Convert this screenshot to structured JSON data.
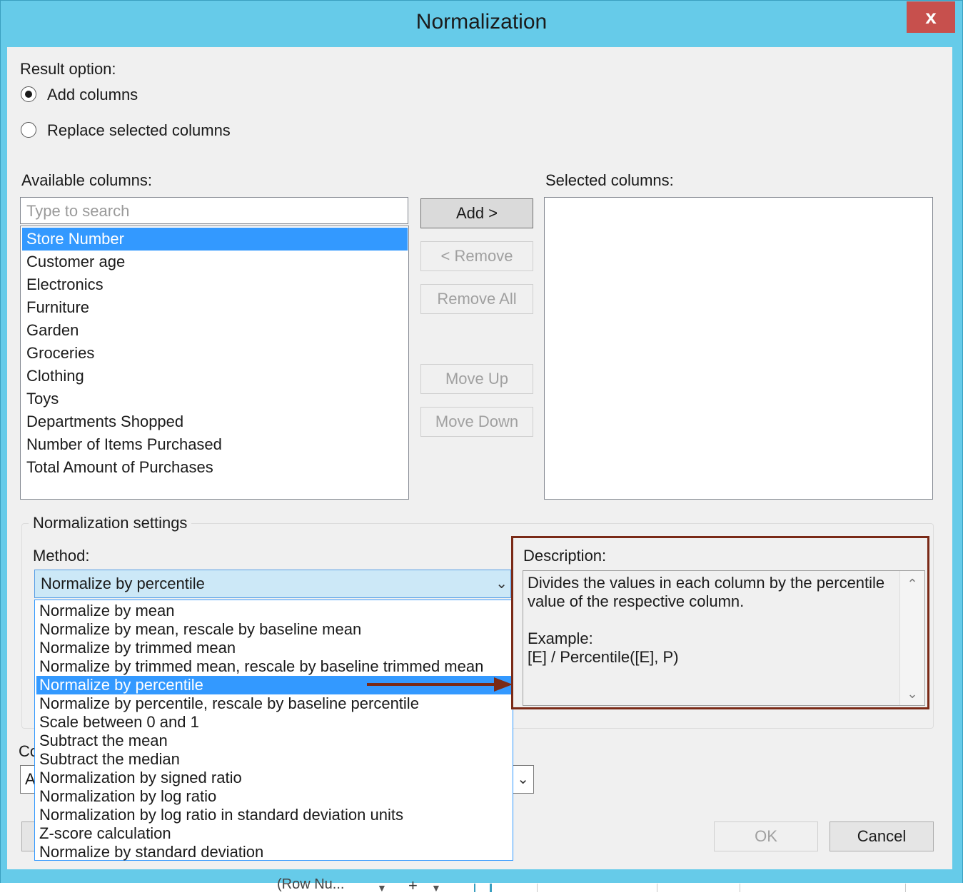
{
  "window": {
    "title": "Normalization",
    "close_label": "x"
  },
  "result_option": {
    "label": "Result option:",
    "options": [
      {
        "label": "Add columns",
        "selected": true
      },
      {
        "label": "Replace selected columns",
        "selected": false
      }
    ]
  },
  "available_columns": {
    "label": "Available columns:",
    "search_placeholder": "Type to search",
    "items": [
      {
        "label": "Store Number",
        "selected": true
      },
      {
        "label": "Customer age",
        "selected": false
      },
      {
        "label": "Electronics",
        "selected": false
      },
      {
        "label": "Furniture",
        "selected": false
      },
      {
        "label": "Garden",
        "selected": false
      },
      {
        "label": "Groceries",
        "selected": false
      },
      {
        "label": "Clothing",
        "selected": false
      },
      {
        "label": "Toys",
        "selected": false
      },
      {
        "label": "Departments Shopped",
        "selected": false
      },
      {
        "label": "Number of Items Purchased",
        "selected": false
      },
      {
        "label": "Total Amount of Purchases",
        "selected": false
      }
    ]
  },
  "buttons": {
    "add": "Add >",
    "remove": "< Remove",
    "remove_all": "Remove All",
    "move_up": "Move Up",
    "move_down": "Move Down",
    "ok": "OK",
    "cancel": "Cancel"
  },
  "selected_columns": {
    "label": "Selected columns:",
    "items": []
  },
  "normalization_settings": {
    "group_label": "Normalization settings",
    "method_label": "Method:",
    "method_value": "Normalize by percentile",
    "method_options": [
      {
        "label": "Normalize by mean",
        "selected": false
      },
      {
        "label": "Normalize by mean, rescale by baseline mean",
        "selected": false
      },
      {
        "label": "Normalize by trimmed mean",
        "selected": false
      },
      {
        "label": "Normalize by trimmed mean, rescale by baseline trimmed mean",
        "selected": false
      },
      {
        "label": "Normalize by percentile",
        "selected": true
      },
      {
        "label": "Normalize by percentile, rescale by baseline percentile",
        "selected": false
      },
      {
        "label": "Scale between 0 and 1",
        "selected": false
      },
      {
        "label": "Subtract the mean",
        "selected": false
      },
      {
        "label": "Subtract the median",
        "selected": false
      },
      {
        "label": "Normalization by signed ratio",
        "selected": false
      },
      {
        "label": "Normalization by log ratio",
        "selected": false
      },
      {
        "label": "Normalization by log ratio in standard deviation units",
        "selected": false
      },
      {
        "label": "Z-score calculation",
        "selected": false
      },
      {
        "label": "Normalize by standard deviation",
        "selected": false
      }
    ],
    "description_label": "Description:",
    "description_text": "Divides the values in each column by the percentile value of the respective column.\n\nExample:\n[E] / Percentile([E], P)"
  },
  "partial": {
    "column_label_fragment": "Co",
    "column_value_fragment": "A"
  },
  "background": {
    "row_number_fragment": "(Row Nu..."
  },
  "colors": {
    "title_bar": "#66cbe9",
    "close_button": "#c7504d",
    "selection": "#3399ff",
    "annotation": "#7a2a17"
  }
}
